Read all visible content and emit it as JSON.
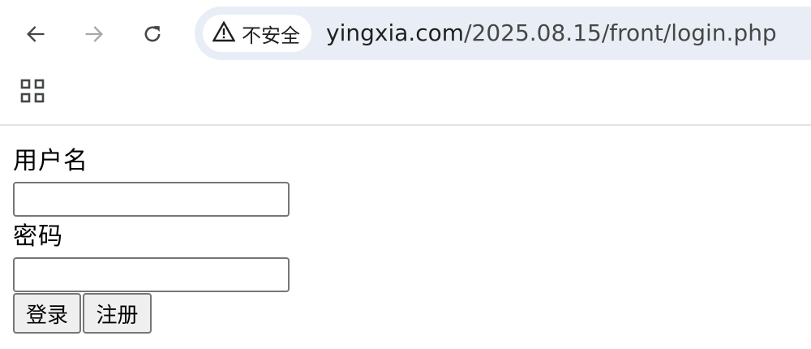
{
  "browser": {
    "nav": {
      "back_icon": "arrow-left-icon",
      "forward_icon": "arrow-right-icon",
      "reload_icon": "reload-icon",
      "apps_icon": "apps-grid-icon"
    },
    "security_chip": {
      "label": "不安全",
      "icon": "warning-triangle-icon"
    },
    "url": {
      "domain": "yingxia.com",
      "path": "/2025.08.15/front/login.php"
    },
    "colors": {
      "omnibox_bg": "#e9eef6",
      "chip_bg": "#ffffff",
      "icon_active": "#444746",
      "icon_disabled": "#a8a8a8"
    }
  },
  "form": {
    "username_label": "用户名",
    "username_value": "",
    "password_label": "密码",
    "password_value": "",
    "login_button": "登录",
    "register_button": "注册"
  }
}
